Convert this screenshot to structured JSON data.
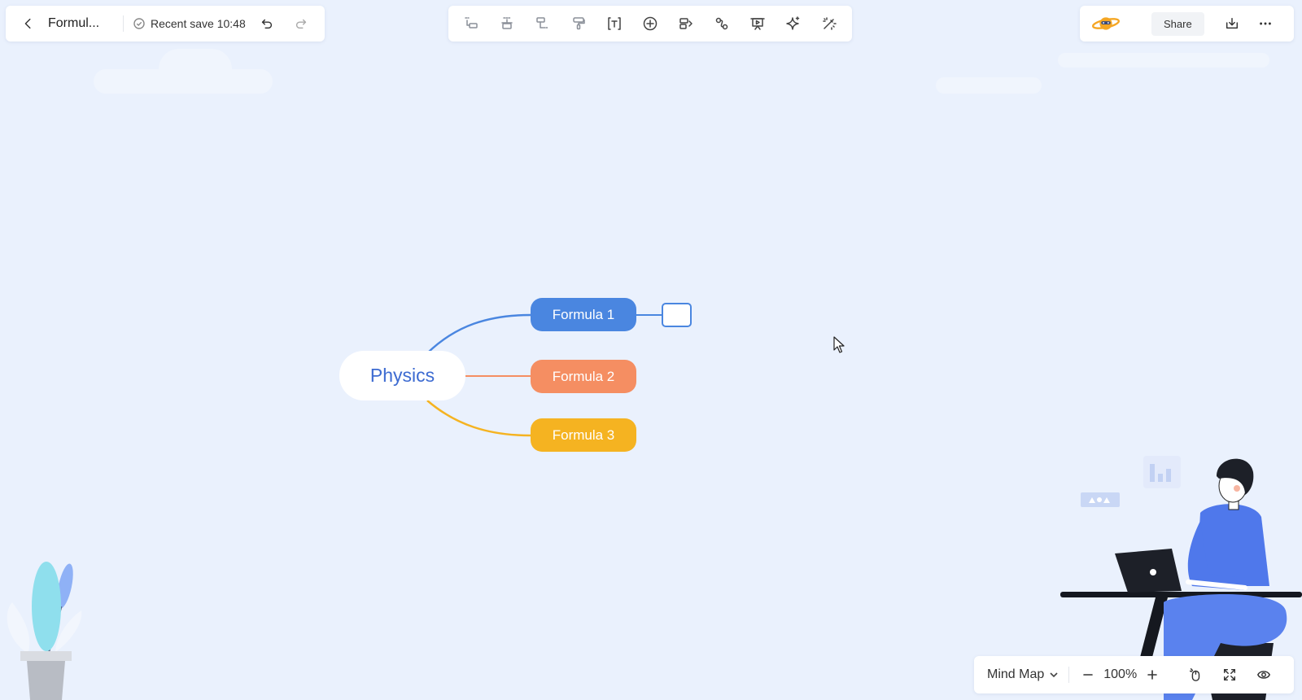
{
  "header": {
    "doc_title": "Formul...",
    "save_status": "Recent save 10:48"
  },
  "toolbar": {
    "tools": [
      "subtopic-icon",
      "sibling-topic-icon",
      "floating-topic-icon",
      "format-painter-icon",
      "text-box-icon",
      "insert-icon",
      "callout-icon",
      "relationship-icon",
      "presentation-icon",
      "ai-sparkle-icon",
      "magic-wand-icon"
    ]
  },
  "right_actions": {
    "share_label": "Share"
  },
  "mindmap": {
    "root": "Physics",
    "topics": [
      {
        "label": "Formula 1",
        "color": "#4a86e0"
      },
      {
        "label": "Formula 2",
        "color": "#f58e62"
      },
      {
        "label": "Formula 3",
        "color": "#f5b321"
      }
    ]
  },
  "status_bar": {
    "map_type": "Mind Map",
    "zoom": "100%"
  },
  "colors": {
    "background": "#eaf1fd",
    "accent": "#3d6bd1"
  }
}
